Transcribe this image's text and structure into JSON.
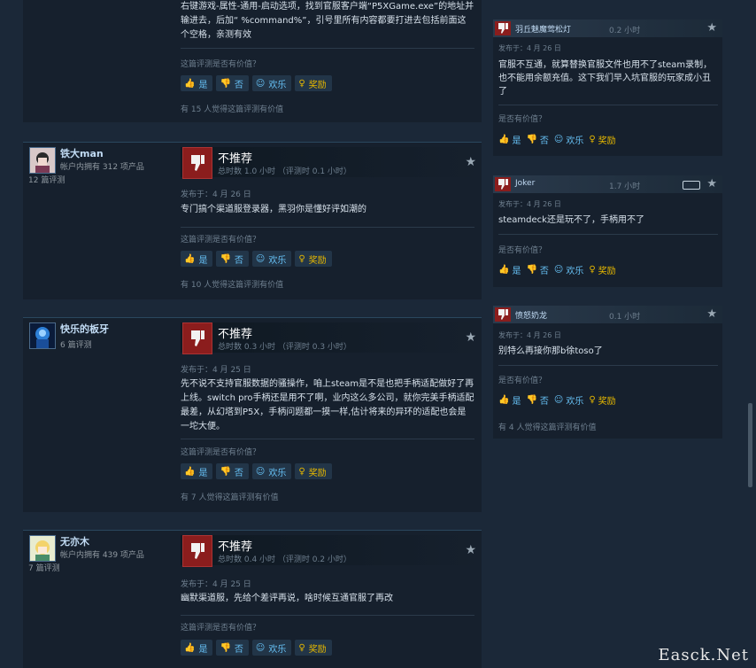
{
  "reviews": [
    {
      "body": "右键游戏-属性-通用-启动选项，找到官服客户端“P5XGame.exe”的地址并输进去，后加“ %command%”，引号里所有内容都要打进去包括前面这个空格，亲测有效",
      "help_q": "这篇评测是否有价值？",
      "buttons": {
        "yes": "是",
        "no": "否",
        "funny": "欢乐",
        "award": "奖励"
      },
      "found": "有 15 人觉得这篇评测有价值"
    },
    {
      "user": "铁大man",
      "products": "帐户内拥有 312 项产品",
      "review_count": "12 篇评测",
      "verdict": "不推荐",
      "hours": "总时数 1.0 小时 （评测时 0.1 小时）",
      "posted": "发布于：4 月 26 日",
      "body": "专门搞个渠道服登录器，黑羽你是懂好评如潮的",
      "help_q": "这篇评测是否有价值？",
      "buttons": {
        "yes": "是",
        "no": "否",
        "funny": "欢乐",
        "award": "奖励"
      },
      "found": "有 10 人觉得这篇评测有价值"
    },
    {
      "user": "快乐的板牙",
      "products": "",
      "review_count": "6 篇评测",
      "verdict": "不推荐",
      "hours": "总时数 0.3 小时 （评测时 0.3 小时）",
      "posted": "发布于：4 月 25 日",
      "body": "先不说不支持官服数据的骚操作，咱上steam是不是也把手柄适配做好了再上线。switch pro手柄还是用不了啊，业内这么多公司，就你完美手柄适配最差，从幻塔到P5X，手柄问题都一摸一样,估计将来的异环的适配也会是一坨大便。",
      "help_q": "这篇评测是否有价值？",
      "buttons": {
        "yes": "是",
        "no": "否",
        "funny": "欢乐",
        "award": "奖励"
      },
      "found": "有 7 人觉得这篇评测有价值"
    },
    {
      "user": "无亦木",
      "products": "帐户内拥有 439 项产品",
      "review_count": "7 篇评测",
      "verdict": "不推荐",
      "hours": "总时数 0.4 小时 （评测时 0.2 小时）",
      "posted": "发布于：4 月 25 日",
      "body": "幽默渠道服，先给个差评再说，啥时候互通官服了再改",
      "help_q": "这篇评测是否有价值？",
      "buttons": {
        "yes": "是",
        "no": "否",
        "funny": "欢乐",
        "award": "奖励"
      }
    }
  ],
  "side_reviews": [
    {
      "user": "羽丘魅魔莺松灯",
      "hours": "0.2 小时",
      "posted": "发布于：4 月 26 日",
      "body": "官服不互通，就算替换官服文件也用不了steam录制，也不能用余额充值。这下我们早入坑官服的玩家成小丑了",
      "help_q": "是否有价值？",
      "buttons": {
        "yes": "是",
        "no": "否",
        "funny": "欢乐",
        "award": "奖励"
      }
    },
    {
      "user": "Joker",
      "hours": "1.7 小时",
      "posted": "发布于：4 月 26 日",
      "body": "steamdeck还是玩不了，手柄用不了",
      "help_q": "是否有价值？",
      "buttons": {
        "yes": "是",
        "no": "否",
        "funny": "欢乐",
        "award": "奖励"
      }
    },
    {
      "user": "愤怒奶龙",
      "hours": "0.1 小时",
      "posted": "发布于：4 月 26 日",
      "body": "别特么再接你那b徐toso了",
      "help_q": "是否有价值？",
      "buttons": {
        "yes": "是",
        "no": "否",
        "funny": "欢乐",
        "award": "奖励"
      },
      "found": "有 4 人觉得这篇评测有价值"
    }
  ],
  "watermark": "Easck.Net",
  "colors": {
    "accent": "#66c0f4",
    "award": "#e6b800",
    "thumb_down": "#8b1d1d",
    "bg": "#1b2838"
  }
}
